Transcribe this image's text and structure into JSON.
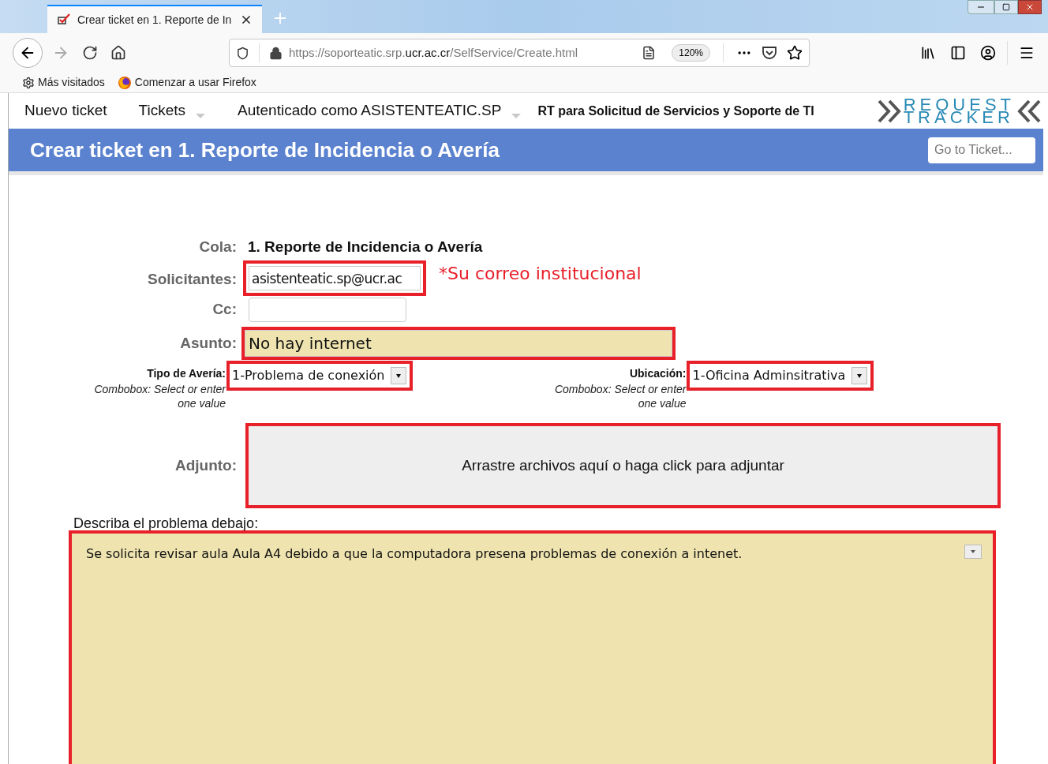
{
  "browser": {
    "tab": {
      "title": "Crear ticket en 1. Reporte de In",
      "selected": true
    },
    "url": {
      "prefix": "https://soporteatic.srp.",
      "domain": "ucr.ac.cr",
      "path": "/SelfService/Create.html"
    },
    "zoom": "120%",
    "bookmarks": {
      "most_visited": "Más visitados",
      "getting_started": "Comenzar a usar Firefox"
    }
  },
  "rt_menu": {
    "items": [
      {
        "label": "Nuevo ticket",
        "dropdown": false
      },
      {
        "label": "Tickets",
        "dropdown": true
      },
      {
        "label": "Autenticado como ASISTENTEATIC.SP",
        "dropdown": true
      }
    ],
    "site_title": "RT para Solicitud de Servicios y Soporte de TI",
    "logo": {
      "line1": "REQUEST",
      "line2": "TRACKER"
    }
  },
  "header": {
    "title": "Crear ticket en 1. Reporte de Incidencia o Avería",
    "search_placeholder": "Go to Ticket..."
  },
  "form": {
    "queue": {
      "label": "Cola:",
      "value": "1. Reporte de Incidencia o Avería"
    },
    "requestors": {
      "label": "Solicitantes:",
      "value": "asistenteatic.sp@ucr.ac",
      "highlighted": true,
      "note": "*Su correo institucional"
    },
    "cc": {
      "label": "Cc:",
      "highlighted": false
    },
    "subject": {
      "label": "Asunto:",
      "value": "No hay internet",
      "highlighted": true
    },
    "combos": [
      {
        "label": "Tipo de Avería:",
        "hint": "Combobox: Select or enter one value",
        "value": "1-Problema de conexión",
        "highlighted": true
      },
      {
        "label": "Ubicación:",
        "hint": "Combobox: Select or enter one value",
        "value": "1-Oficina Adminsitrativa",
        "highlighted": true
      }
    ],
    "attachment": {
      "label": "Adjunto:",
      "dropzone": "Arrastre archivos aquí o haga click para adjuntar",
      "highlighted": true
    },
    "description": {
      "label": "Describa el problema debajo:",
      "value": "Se solicita revisar aula Aula A4 debido a que la computadora presena problemas de conexión a intenet.",
      "highlighted": true
    }
  }
}
